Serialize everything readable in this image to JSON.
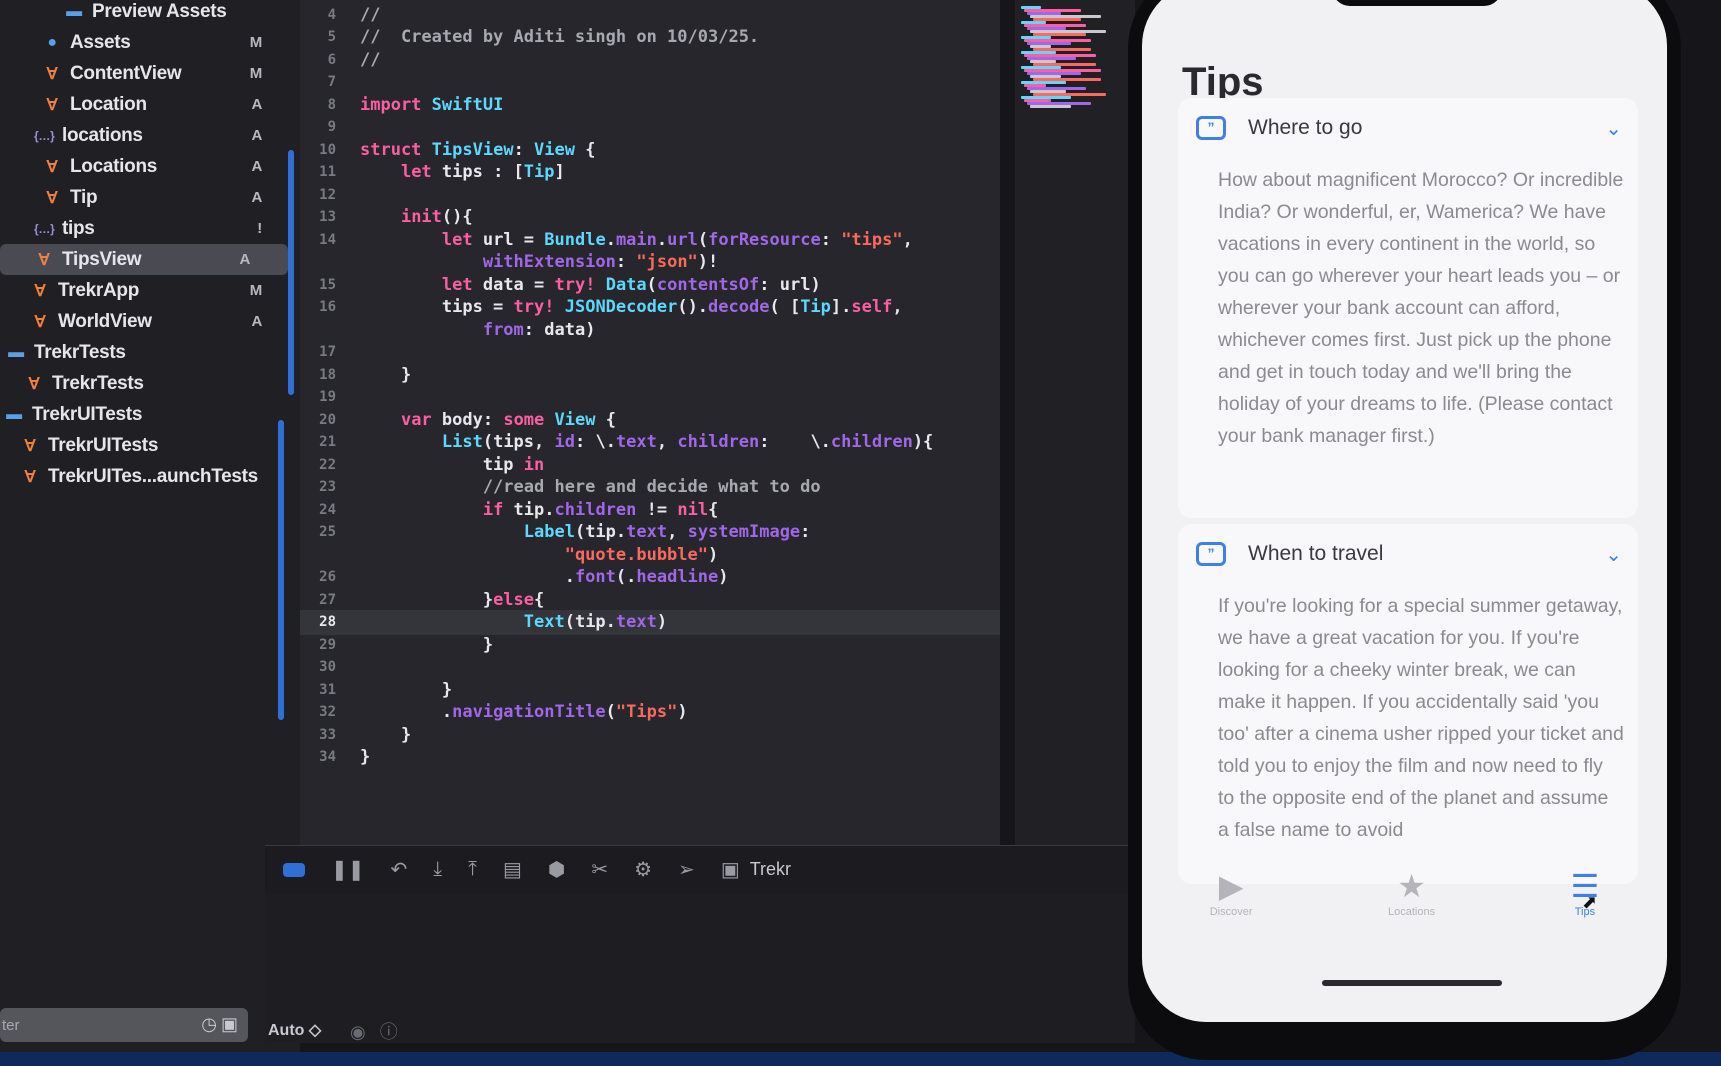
{
  "navigator": {
    "items": [
      {
        "label": "Preview Assets",
        "icon": "folder-icon",
        "badge": ""
      },
      {
        "label": "Assets",
        "icon": "asset-catalog-icon",
        "badge": "M"
      },
      {
        "label": "ContentView",
        "icon": "swift-file-icon",
        "badge": "M"
      },
      {
        "label": "Location",
        "icon": "swift-file-icon",
        "badge": "A"
      },
      {
        "label": "locations",
        "icon": "json-file-icon",
        "badge": "A"
      },
      {
        "label": "Locations",
        "icon": "swift-file-icon",
        "badge": "A"
      },
      {
        "label": "Tip",
        "icon": "swift-file-icon",
        "badge": "A"
      },
      {
        "label": "tips",
        "icon": "json-file-icon",
        "badge": "!"
      },
      {
        "label": "TipsView",
        "icon": "swift-file-icon",
        "badge": "A"
      },
      {
        "label": "TrekrApp",
        "icon": "swift-file-icon",
        "badge": "M"
      },
      {
        "label": "WorldView",
        "icon": "swift-file-icon",
        "badge": "A"
      },
      {
        "label": "TrekrTests",
        "icon": "folder-icon",
        "badge": ""
      },
      {
        "label": "TrekrTests",
        "icon": "swift-file-icon",
        "badge": ""
      },
      {
        "label": "TrekrUITests",
        "icon": "folder-icon",
        "badge": ""
      },
      {
        "label": "TrekrUITests",
        "icon": "swift-file-icon",
        "badge": ""
      },
      {
        "label": "TrekrUITes...aunchTests",
        "icon": "swift-file-icon",
        "badge": ""
      }
    ],
    "selected_label": "TipsView",
    "filter_placeholder": "ter"
  },
  "editor": {
    "current_line": "28",
    "lines": [
      {
        "n": "4",
        "code": "//"
      },
      {
        "n": "5",
        "code": "//  Created by Aditi singh on 10/03/25."
      },
      {
        "n": "6",
        "code": "//"
      },
      {
        "n": "7",
        "code": ""
      },
      {
        "n": "8",
        "code": "import SwiftUI"
      },
      {
        "n": "9",
        "code": ""
      },
      {
        "n": "10",
        "code": "struct TipsView: View {"
      },
      {
        "n": "11",
        "code": "    let tips : [Tip]"
      },
      {
        "n": "12",
        "code": ""
      },
      {
        "n": "13",
        "code": "    init(){"
      },
      {
        "n": "14",
        "code": "        let url = Bundle.main.url(forResource: \"tips\","
      },
      {
        "n": "",
        "code": "            withExtension: \"json\")!"
      },
      {
        "n": "15",
        "code": "        let data = try! Data(contentsOf: url)"
      },
      {
        "n": "16",
        "code": "        tips = try! JSONDecoder().decode( [Tip].self,"
      },
      {
        "n": "",
        "code": "            from: data)"
      },
      {
        "n": "17",
        "code": ""
      },
      {
        "n": "18",
        "code": "    }"
      },
      {
        "n": "19",
        "code": ""
      },
      {
        "n": "20",
        "code": "    var body: some View {"
      },
      {
        "n": "21",
        "code": "        List(tips, id: \\.text, children:    \\.children){"
      },
      {
        "n": "22",
        "code": "            tip in"
      },
      {
        "n": "23",
        "code": "            //read here and decide what to do"
      },
      {
        "n": "24",
        "code": "            if tip.children != nil{"
      },
      {
        "n": "25",
        "code": "                Label(tip.text, systemImage:"
      },
      {
        "n": "",
        "code": "                    \"quote.bubble\")"
      },
      {
        "n": "26",
        "code": "                    .font(.headline)"
      },
      {
        "n": "27",
        "code": "            }else{"
      },
      {
        "n": "28",
        "code": "                Text(tip.text)"
      },
      {
        "n": "29",
        "code": "            }"
      },
      {
        "n": "30",
        "code": ""
      },
      {
        "n": "31",
        "code": "        }"
      },
      {
        "n": "32",
        "code": "        .navigationTitle(\"Tips\")"
      },
      {
        "n": "33",
        "code": "    }"
      },
      {
        "n": "34",
        "code": "}"
      }
    ]
  },
  "debug_bar": {
    "scheme": "Trekr",
    "icons": [
      "breakpoint-toggle-icon",
      "pause-icon",
      "step-over-icon",
      "step-into-icon",
      "step-out-icon",
      "view-hierarchy-icon",
      "memory-graph-icon",
      "environment-icon",
      "simulate-location-icon",
      "location-arrow-icon",
      "app-icon"
    ]
  },
  "status": {
    "auto_label": "Auto ◇"
  },
  "phone": {
    "nav_title": "Tips",
    "tips": [
      {
        "title": "Where to go",
        "body": "How about magnificent Morocco? Or incredible India? Or wonderful, er, Wamerica? We have vacations in every continent in the world, so you can go wherever your heart leads you – or wherever your bank account can afford, whichever comes first. Just pick up the phone and get in touch today and we'll bring the holiday of your dreams to life. (Please contact your bank manager first.)"
      },
      {
        "title": "When to travel",
        "body": "If you're looking for a special summer getaway, we have a great vacation for you. If you're looking for a cheeky winter break, we can make it happen. If you accidentally said 'you too' after a cinema usher ripped your ticket and told you to enjoy the film and now need to fly to the opposite end of the planet and assume a false name to avoid"
      }
    ],
    "tabs": [
      {
        "label": "Discover",
        "icon": "play-circle-icon"
      },
      {
        "label": "Locations",
        "icon": "star-icon"
      },
      {
        "label": "Tips",
        "icon": "list-icon"
      }
    ]
  },
  "colors": {
    "keyword": "#fc5fa3",
    "type": "#5dd8ff",
    "call": "#a167e6",
    "string": "#fc6a5d",
    "comment": "#a8a8b0",
    "accent": "#3e80e6"
  }
}
